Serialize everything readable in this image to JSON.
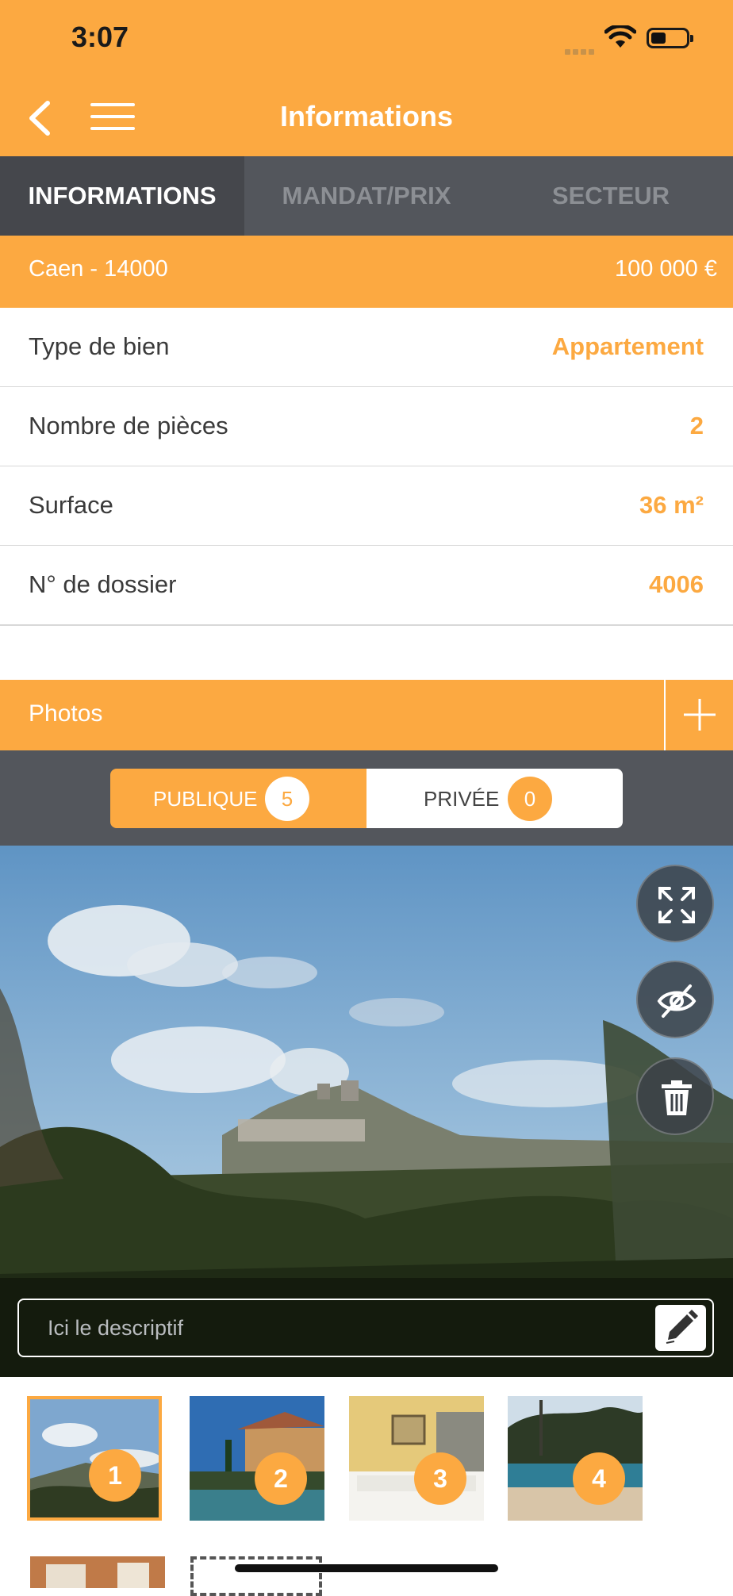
{
  "status_bar": {
    "time": "3:07"
  },
  "navbar": {
    "title": "Informations",
    "back_icon": "chevron-left-icon",
    "menu_icon": "hamburger-menu-icon"
  },
  "tabs": [
    {
      "label": "INFORMATIONS",
      "active": true
    },
    {
      "label": "MANDAT/PRIX",
      "active": false
    },
    {
      "label": "SECTEUR",
      "active": false
    }
  ],
  "location_bar": {
    "location": "Caen - 14000",
    "price": "100 000 €"
  },
  "details": [
    {
      "label": "Type de bien",
      "value": "Appartement"
    },
    {
      "label": "Nombre de pièces",
      "value": "2"
    },
    {
      "label": "Surface",
      "value": "36 m²"
    },
    {
      "label": "N° de dossier",
      "value": "4006"
    }
  ],
  "photos": {
    "header": "Photos",
    "add_icon": "plus-icon",
    "segments": {
      "public": {
        "label": "PUBLIQUE",
        "count": "5"
      },
      "private": {
        "label": "PRIVÉE",
        "count": "0"
      }
    },
    "actions": [
      "fullscreen-icon",
      "eye-off-icon",
      "trash-icon"
    ],
    "description_placeholder": "Ici le descriptif",
    "thumbnails": [
      {
        "number": "1",
        "selected": true
      },
      {
        "number": "2",
        "selected": false
      },
      {
        "number": "3",
        "selected": false
      },
      {
        "number": "4",
        "selected": false
      }
    ]
  },
  "colors": {
    "accent": "#fca941",
    "dark": "#53565c",
    "tab_active": "#45474c"
  }
}
